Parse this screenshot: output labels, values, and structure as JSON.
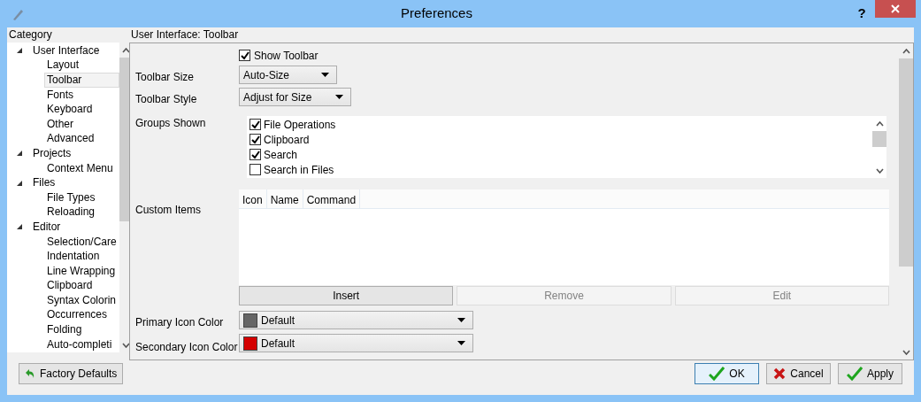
{
  "window": {
    "title": "Preferences",
    "help": "?"
  },
  "category": {
    "label": "Category",
    "tree": [
      {
        "label": "User Interface",
        "expanded": true,
        "selected": false,
        "children": [
          {
            "label": "Layout",
            "selected": false
          },
          {
            "label": "Toolbar",
            "selected": true
          },
          {
            "label": "Fonts",
            "selected": false
          },
          {
            "label": "Keyboard",
            "selected": false
          },
          {
            "label": "Other",
            "selected": false
          },
          {
            "label": "Advanced",
            "selected": false
          }
        ]
      },
      {
        "label": "Projects",
        "expanded": true,
        "selected": false,
        "children": [
          {
            "label": "Context Menu",
            "selected": false
          }
        ]
      },
      {
        "label": "Files",
        "expanded": true,
        "selected": false,
        "children": [
          {
            "label": "File Types",
            "selected": false
          },
          {
            "label": "Reloading",
            "selected": false
          }
        ]
      },
      {
        "label": "Editor",
        "expanded": true,
        "selected": false,
        "children": [
          {
            "label": "Selection/Care",
            "selected": false
          },
          {
            "label": "Indentation",
            "selected": false
          },
          {
            "label": "Line Wrapping",
            "selected": false
          },
          {
            "label": "Clipboard",
            "selected": false
          },
          {
            "label": "Syntax Colorin",
            "selected": false
          },
          {
            "label": "Occurrences",
            "selected": false
          },
          {
            "label": "Folding",
            "selected": false
          },
          {
            "label": "Auto-completi",
            "selected": false
          }
        ]
      }
    ]
  },
  "page": {
    "heading": "User Interface: Toolbar",
    "show_toolbar": {
      "label": "Show Toolbar",
      "checked": true
    },
    "fields": [
      {
        "label": "Toolbar Size",
        "value": "Auto-Size"
      },
      {
        "label": "Toolbar Style",
        "value": "Adjust for Size"
      }
    ],
    "groups": {
      "label": "Groups Shown",
      "items": [
        {
          "label": "File Operations",
          "checked": true
        },
        {
          "label": "Clipboard",
          "checked": true
        },
        {
          "label": "Search",
          "checked": true
        },
        {
          "label": "Search in Files",
          "checked": false
        }
      ]
    },
    "custom_items": {
      "label": "Custom Items",
      "columns": [
        "Icon",
        "Name",
        "Command"
      ],
      "buttons": [
        {
          "label": "Insert",
          "disabled": false
        },
        {
          "label": "Remove",
          "disabled": true
        },
        {
          "label": "Edit",
          "disabled": true
        }
      ]
    },
    "colors": [
      {
        "label": "Primary Icon Color",
        "value": "Default",
        "color": "#666666"
      },
      {
        "label": "Secondary Icon Color",
        "value": "Default",
        "color": "#d40000"
      }
    ]
  },
  "footer": {
    "factory_defaults": "Factory Defaults",
    "buttons": [
      {
        "label": "OK",
        "kind": "check",
        "focused": true
      },
      {
        "label": "Cancel",
        "kind": "cross",
        "focused": false
      },
      {
        "label": "Apply",
        "kind": "check",
        "focused": false
      }
    ]
  }
}
